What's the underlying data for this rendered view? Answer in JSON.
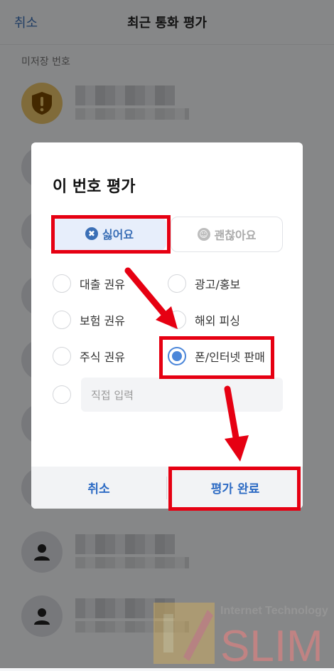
{
  "topbar": {
    "cancel_label": "취소",
    "title": "최근 통화 평가"
  },
  "section_label": "미저장 번호",
  "modal": {
    "title": "이 번호 평가",
    "tabs": [
      {
        "label": "싫어요",
        "active": true
      },
      {
        "label": "괜찮아요",
        "active": false
      }
    ],
    "options": [
      {
        "label": "대출 권유",
        "selected": false
      },
      {
        "label": "광고/홍보",
        "selected": false
      },
      {
        "label": "보험 권유",
        "selected": false
      },
      {
        "label": "해외 피싱",
        "selected": false
      },
      {
        "label": "주식 권유",
        "selected": false
      },
      {
        "label": "폰/인터넷 판매",
        "selected": true
      }
    ],
    "direct_input": {
      "placeholder": "직접 입력",
      "value": ""
    },
    "footer": {
      "cancel_label": "취소",
      "done_label": "평가 완료"
    }
  },
  "watermark": {
    "line1": "Internet Technology",
    "line2": "SLIM"
  },
  "colors": {
    "accent": "#3b6fb6",
    "highlight": "#e60012",
    "radio_on": "#4b86d9"
  }
}
